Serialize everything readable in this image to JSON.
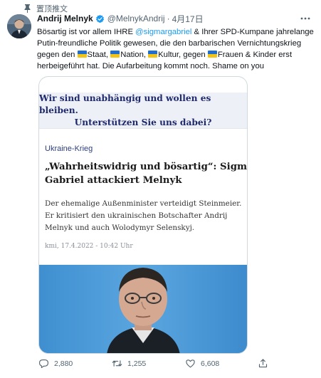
{
  "pinned": {
    "label": "置顶推文"
  },
  "tweet": {
    "display_name": "Andrij Melnyk",
    "handle": "@MelnykAndrij",
    "separator": "·",
    "time": "4月17日",
    "text": {
      "line1_a": "Bösartig ist vor allem IHRE ",
      "mention": "@sigmargabriel",
      "line1_b": " & Ihrer SPD-Kumpane jahrelange",
      "line2": "Putin-freundliche Politik gewesen, die den barbarischen Vernichtungskrieg",
      "line3_a": "gegen den ",
      "line3_staat": "Staat, ",
      "line3_nation": "Nation, ",
      "line3_kultur": "Kultur, gegen ",
      "line3_frauen": "Frauen & Kinder erst",
      "line4": "herbeigeführt hat. Die Aufarbeitung kommt noch. Shame on you"
    }
  },
  "card": {
    "banner_line1": "Wir sind unabhängig und wollen es bleiben.",
    "banner_line2": "Unterstützen Sie uns dabei?",
    "kicker": "Ukraine-Krieg",
    "headline_line1": "„Wahrheitswidrig und bösartig“: Sigmar",
    "headline_line2": "Gabriel attackiert Melnyk",
    "lede_line1": "Der ehemalige Außenminister verteidigt Steinmeier.",
    "lede_line2": "Er kritisiert den ukrainischen Botschafter Andrij",
    "lede_line3": "Melnyk und auch Wolodymyr Selenskyj.",
    "dateline": "kmi, 17.4.2022 - 10:42 Uhr"
  },
  "actions": {
    "replies": "2,880",
    "retweets": "1,255",
    "likes": "6,608"
  },
  "colors": {
    "link": "#1d9bf0",
    "muted": "#536471",
    "verified": "#1d9bf0",
    "flag_blue": "#1e6fd0",
    "flag_yellow": "#f2c418",
    "banner_bg": "#eef0f7",
    "banner_text": "#1e2a6b"
  },
  "icons": [
    "pin-icon",
    "verified-icon",
    "more-icon",
    "reply-icon",
    "retweet-icon",
    "like-icon",
    "share-icon"
  ]
}
